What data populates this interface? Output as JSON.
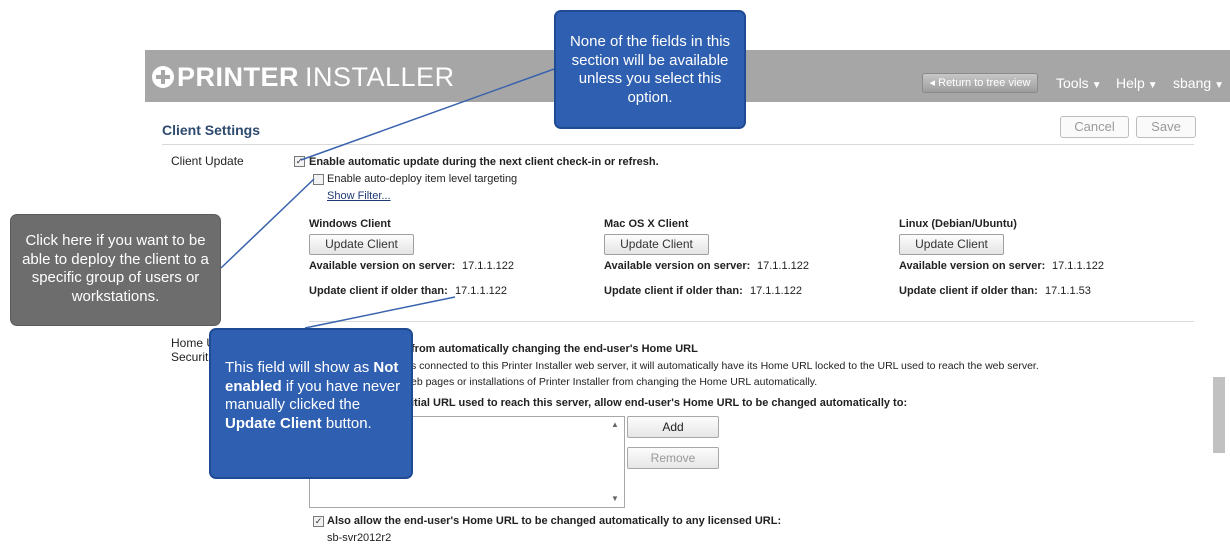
{
  "header": {
    "logo_bold": "PRINTER",
    "logo_light": "INSTALLER",
    "return_label": "Return to tree view",
    "menus": {
      "tools": "Tools",
      "help": "Help",
      "user": "sbang"
    }
  },
  "client_settings": {
    "title": "Client Settings",
    "cancel_label": "Cancel",
    "save_label": "Save",
    "client_update_label": "Client Update",
    "enable_auto_update": "Enable automatic update during the next client check-in or refresh.",
    "enable_targeting": "Enable auto-deploy item level targeting",
    "show_filter": "Show Filter...",
    "clients": [
      {
        "name": "Windows Client",
        "button": "Update Client",
        "available_label": "Available version on server:",
        "available": "17.1.1.122",
        "older_label": "Update client if older than:",
        "older": "17.1.1.122"
      },
      {
        "name": "Mac OS X Client",
        "button": "Update Client",
        "available_label": "Available version on server:",
        "available": "17.1.1.122",
        "older_label": "Update client if older than:",
        "older": "17.1.1.122"
      },
      {
        "name": "Linux (Debian/Ubuntu)",
        "button": "Update Client",
        "available_label": "Available version on server:",
        "available": "17.1.1.122",
        "older_label": "Update client if older than:",
        "older": "17.1.1.53"
      }
    ]
  },
  "home_url": {
    "label_line1": "Home U",
    "label_line2": "Securit",
    "heading": "from automatically changing the end-user's Home URL",
    "desc1": "s connected to this Printer Installer web server, it will automatically have its Home URL locked to the URL used to reach the web server.",
    "desc2": "eb pages or installations of Printer Installer from changing the Home URL automatically.",
    "initial_url_text": "itial URL used to reach this server, allow end-user's Home URL to be changed automatically to:",
    "add_label": "Add",
    "remove_label": "Remove",
    "also_allow": "Also allow the end-user's Home URL to be changed automatically to any licensed URL:",
    "licensed_url": "sb-svr2012r2"
  },
  "callouts": {
    "top": "None of the fields in this section will be available unless you select this option.",
    "left": "Click here if you want to be able to deploy the client to a specific group of users or workstations.",
    "bottom_p1": "This field will show as ",
    "bottom_b1": "Not enabled",
    "bottom_p2": " if you have never manually clicked the ",
    "bottom_b2": "Update Client",
    "bottom_p3": " button."
  },
  "colors": {
    "header_gray": "#a6a6a6",
    "callout_blue": "#2f5fb0",
    "callout_gray": "#6d6d6d",
    "title_blue": "#2e4a6e"
  }
}
